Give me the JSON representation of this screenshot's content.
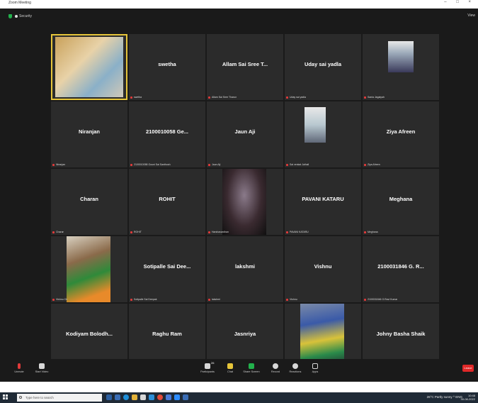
{
  "window": {
    "title": "Zoom Meeting"
  },
  "topbar": {
    "security_label": "Security",
    "view_label": "View"
  },
  "colors": {
    "background": "#1a1a1a",
    "tile": "#2b2b2b",
    "active_speaker": "#e6c53a",
    "leave": "#e02828",
    "muted_mic": "#e03a3a"
  },
  "participants": [
    {
      "display": "",
      "tag": "",
      "video": true,
      "active": true
    },
    {
      "display": "swetha",
      "tag": "swetha",
      "video": false
    },
    {
      "display": "Allam Sai Sree T...",
      "tag": "Allam Sai Sree Tharun",
      "video": false
    },
    {
      "display": "Uday sai yadla",
      "tag": "Uday sai yadla",
      "video": false
    },
    {
      "display": "",
      "tag": "Sania Jagaiyah",
      "video": true
    },
    {
      "display": "Niranjan",
      "tag": "Niranjan",
      "video": false
    },
    {
      "display": "2100010058 Ge...",
      "tag": "2100010058 Gouni Sai Santhosh",
      "video": false
    },
    {
      "display": "Jaun Aji",
      "tag": "Jaun Aji",
      "video": false
    },
    {
      "display": "",
      "tag": "Sai venkat Jaihali",
      "video": true
    },
    {
      "display": "Ziya Afreen",
      "tag": "Ziya Afreen",
      "video": false
    },
    {
      "display": "Charan",
      "tag": "Charan",
      "video": false
    },
    {
      "display": "ROHIT",
      "tag": "ROHIT",
      "video": false
    },
    {
      "display": "",
      "tag": "Harshavardhan",
      "video": true
    },
    {
      "display": "PAVANI KATARU",
      "tag": "PAVANI KATARU",
      "video": false
    },
    {
      "display": "Meghana",
      "tag": "Meghana",
      "video": false
    },
    {
      "display": "",
      "tag": "Vishnu Ch",
      "video": true
    },
    {
      "display": "Sotipalle Sai Dee...",
      "tag": "Sotipalle Sai Deepak",
      "video": false
    },
    {
      "display": "lakshmi",
      "tag": "lakshmi",
      "video": false
    },
    {
      "display": "Vishnu",
      "tag": "Vishnu",
      "video": false
    },
    {
      "display": "2100031846 G. R...",
      "tag": "2100031846 G.Ravi Kumar",
      "video": false
    },
    {
      "display": "Kodiyam Bolodh...",
      "tag": "Kodiyam Bolodhitha",
      "video": false
    },
    {
      "display": "Raghu Ram",
      "tag": "Raghu Ram",
      "video": false
    },
    {
      "display": "Jasnriya",
      "tag": "Jasnriya",
      "video": false
    },
    {
      "display": "",
      "tag": "Sai Kiran Ch",
      "video": true
    },
    {
      "display": "Johny Basha Shaik",
      "tag": "Johny Basha Shaik",
      "video": false
    }
  ],
  "toolbar": {
    "mute": "Unmute",
    "video": "Start Video",
    "participants": "Participants",
    "participants_count": "26",
    "chat": "Chat",
    "share": "Share Screen",
    "record": "Record",
    "reactions": "Reactions",
    "apps": "Apps",
    "leave": "Leave"
  },
  "taskbar": {
    "search_placeholder": "Type here to search",
    "tray": "26°C Partly sunny  ^  ENG",
    "time": "10:48",
    "date": "30-08-2022"
  }
}
